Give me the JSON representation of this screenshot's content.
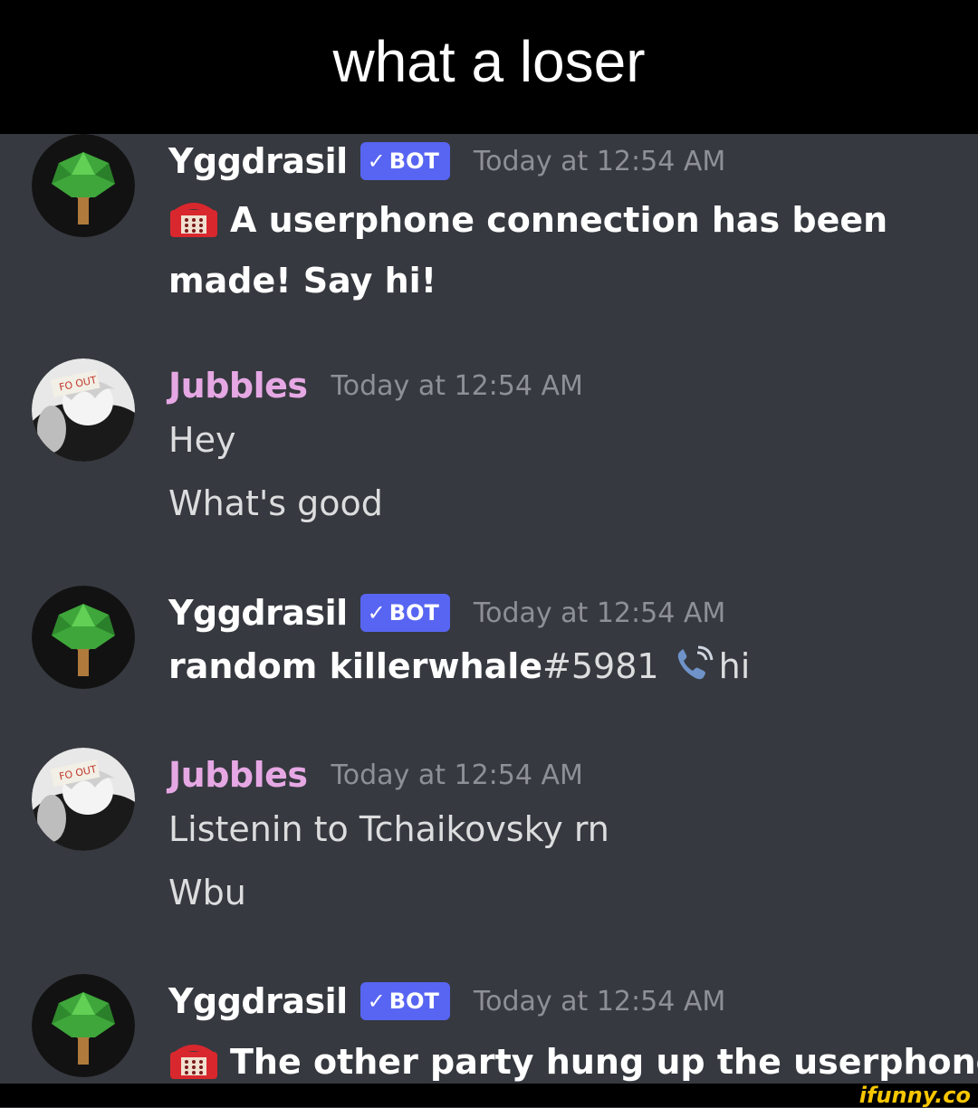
{
  "caption": "what a loser",
  "messages": [
    {
      "username": "Yggdrasil",
      "bot_tag": "BOT",
      "timestamp": "Today at 12:54 AM",
      "lines": [
        "A userphone connection has been",
        "made! Say hi!"
      ]
    },
    {
      "username": "Jubbles",
      "timestamp": "Today at 12:54 AM",
      "lines": [
        "Hey",
        "What's good"
      ]
    },
    {
      "username": "Yggdrasil",
      "bot_tag": "BOT",
      "timestamp": "Today at 12:54 AM",
      "sender_bold": "random killerwhale",
      "sender_discriminator": "#5981",
      "text": "hi"
    },
    {
      "username": "Jubbles",
      "timestamp": "Today at 12:54 AM",
      "lines": [
        "Listenin to Tchaikovsky rn",
        "Wbu"
      ]
    },
    {
      "username": "Yggdrasil",
      "bot_tag": "BOT",
      "timestamp": "Today at 12:54 AM",
      "lines": [
        "The other party hung up the userphone."
      ]
    }
  ],
  "icons": {
    "tree_avatar": "tree-avatar",
    "user_avatar": "anime-avatar",
    "telephone": "telephone-emoji",
    "call": "phone-call-icon",
    "check": "checkmark-icon"
  },
  "watermark": "ifunny.co",
  "colors": {
    "background": "#36393f",
    "bot_tag": "#5865f2",
    "user_name": "#e6a8e4",
    "timestamp": "#8d9096",
    "text": "#dcddde"
  }
}
